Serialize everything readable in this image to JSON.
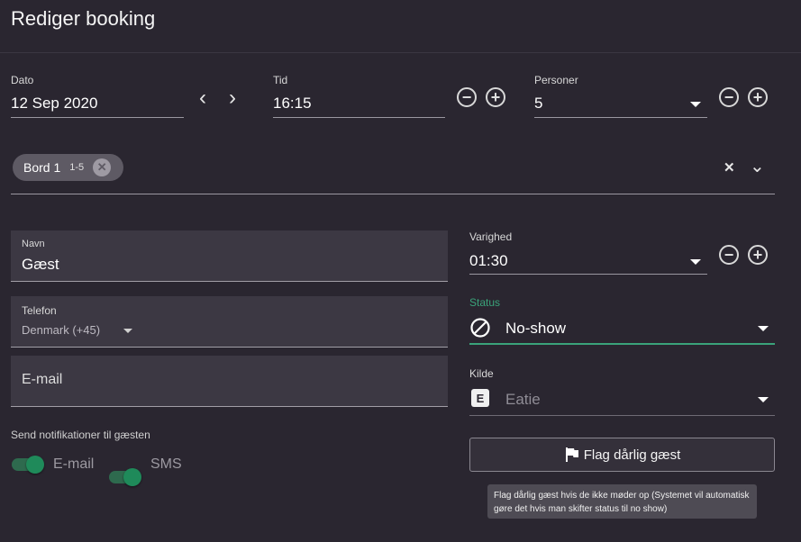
{
  "header": {
    "title": "Rediger booking"
  },
  "date": {
    "label": "Dato",
    "value": "12 Sep 2020"
  },
  "time": {
    "label": "Tid",
    "value": "16:15"
  },
  "persons": {
    "label": "Personer",
    "value": "5"
  },
  "table_chip": {
    "name": "Bord 1",
    "capacity": "1-5"
  },
  "name_field": {
    "label": "Navn",
    "value": "Gæst"
  },
  "phone_field": {
    "label": "Telefon",
    "country": "Denmark (+45)"
  },
  "email_field": {
    "placeholder": "E-mail"
  },
  "notifications": {
    "label": "Send notifikationer til gæsten",
    "email_label": "E-mail",
    "email_on": true,
    "sms_label": "SMS",
    "sms_on": true
  },
  "duration": {
    "label": "Varighed",
    "value": "01:30"
  },
  "status": {
    "label": "Status",
    "value": "No-show",
    "icon": "block-icon",
    "accent": "#3aa37a"
  },
  "source": {
    "label": "Kilde",
    "value": "Eatie",
    "icon_letter": "E"
  },
  "flag_button": {
    "label": "Flag dårlig gæst"
  },
  "tooltip": {
    "text": "Flag dårlig gæst hvis de ikke møder op (Systemet vil automatisk gøre det hvis man skifter status til no show)"
  },
  "glyphs": {
    "minus": "−",
    "plus": "+",
    "prev": "‹",
    "next": "›",
    "clear": "✕",
    "chip_clear": "✕",
    "expand": "⌄"
  }
}
